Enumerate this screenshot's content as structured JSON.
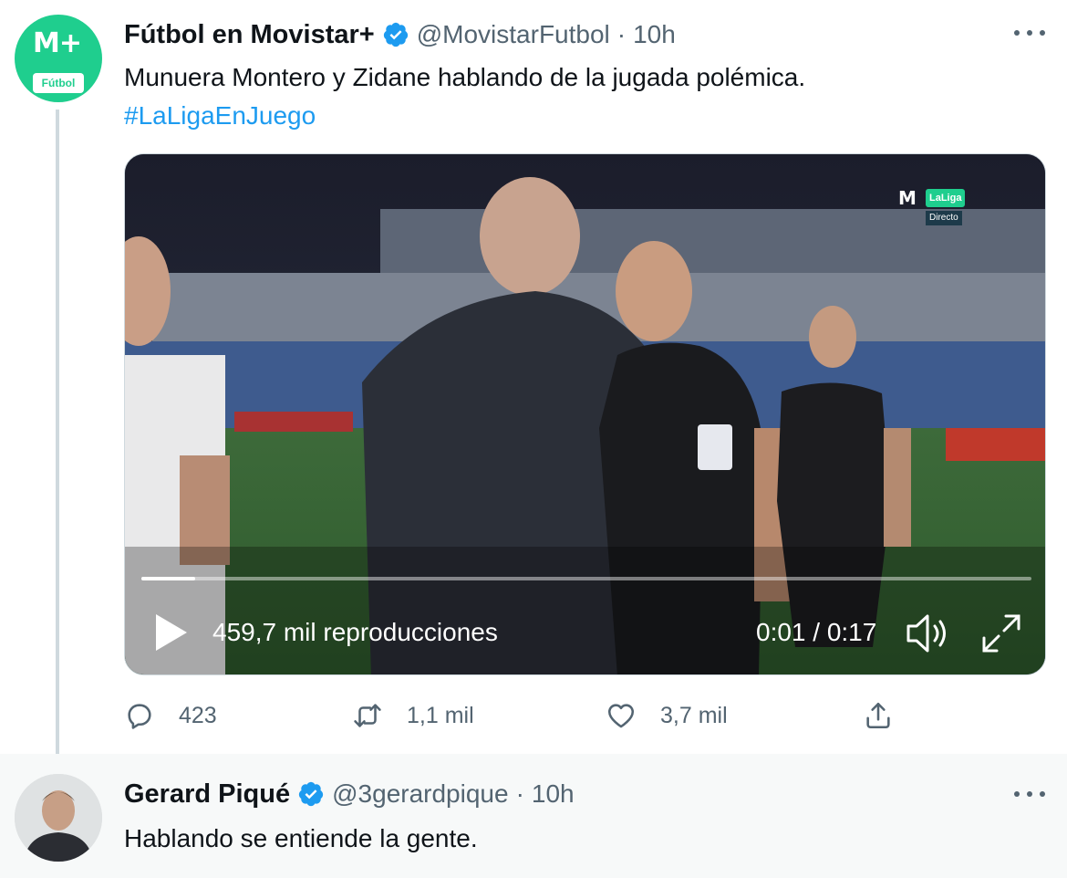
{
  "tweets": [
    {
      "author_name": "Fútbol en Movistar+",
      "handle": "@MovistarFutbol",
      "separator": "·",
      "time": "10h",
      "avatar_text": "M+",
      "avatar_badge": "Fútbol",
      "text": "Munuera Montero y Zidane hablando de la jugada polémica.",
      "hashtag": "#LaLigaEnJuego",
      "video": {
        "views": "459,7 mil reproducciones",
        "time": "0:01 / 0:17",
        "progress": 0.06,
        "overlay_brand": "M",
        "overlay_league": "LaLiga",
        "overlay_status": "Directo"
      },
      "actions": {
        "replies": "423",
        "retweets": "1,1 mil",
        "likes": "3,7 mil"
      }
    },
    {
      "author_name": "Gerard Piqué",
      "handle": "@3gerardpique",
      "separator": "·",
      "time": "10h",
      "text": "Hablando se entiende la gente."
    }
  ],
  "colors": {
    "accent": "#1d9bf0",
    "brand_green": "#1fce8e",
    "muted": "#536471",
    "text": "#0f1419",
    "reply_bg": "#f7f9f9"
  },
  "icons": [
    "verified-icon",
    "more-icon",
    "play-icon",
    "volume-icon",
    "fullscreen-icon",
    "reply-icon",
    "retweet-icon",
    "like-icon",
    "share-icon"
  ]
}
